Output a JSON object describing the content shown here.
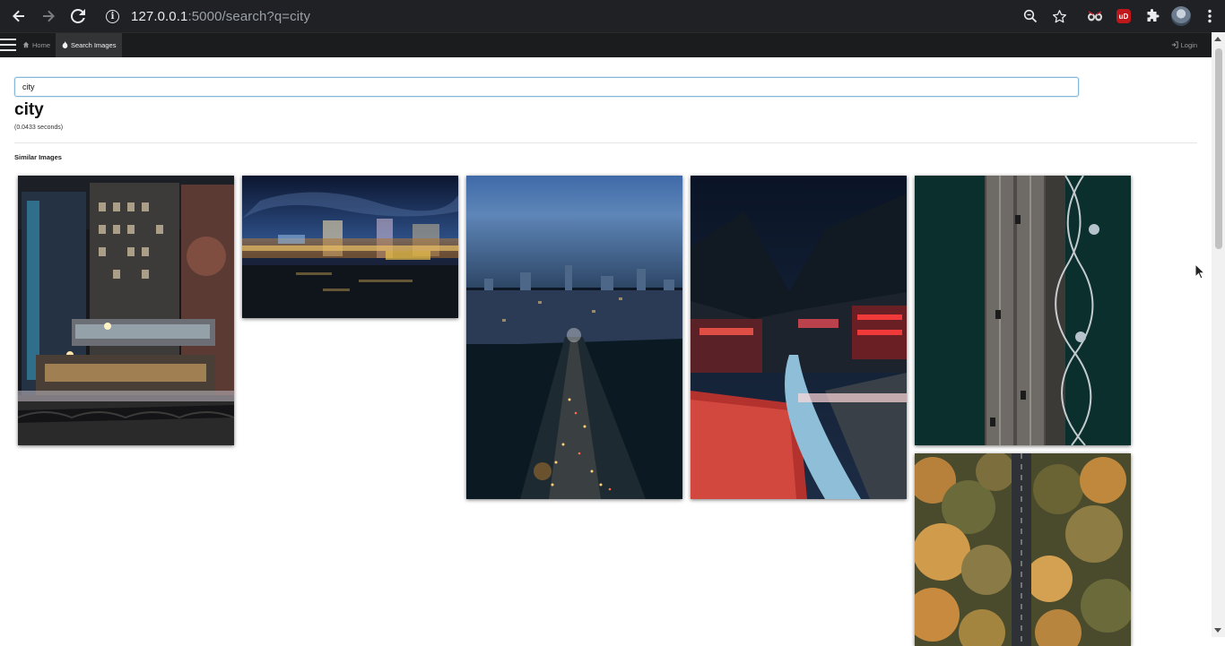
{
  "browser": {
    "url_host": "127.0.0.1",
    "url_rest": ":5000/search?q=city",
    "icons": [
      "back-arrow-icon",
      "forward-arrow-icon",
      "reload-icon",
      "info-icon",
      "zoom-icon",
      "star-icon",
      "extension-icon",
      "menu-icon"
    ]
  },
  "navbar": {
    "home_label": "Home",
    "search_label": "Search Images",
    "login_label": "Login"
  },
  "search": {
    "value": "city"
  },
  "results": {
    "title": "city",
    "timing": "(0.0433 seconds)",
    "section_title": "Similar Images"
  },
  "images": [
    {
      "subject": "night-street-buildings"
    },
    {
      "subject": "blurred-skyline-night"
    },
    {
      "subject": "highway-aerial-dusk"
    },
    {
      "subject": "red-lit-valley-town"
    },
    {
      "subject": "aerial-bridge-river"
    },
    {
      "subject": "aerial-road-forest"
    }
  ]
}
